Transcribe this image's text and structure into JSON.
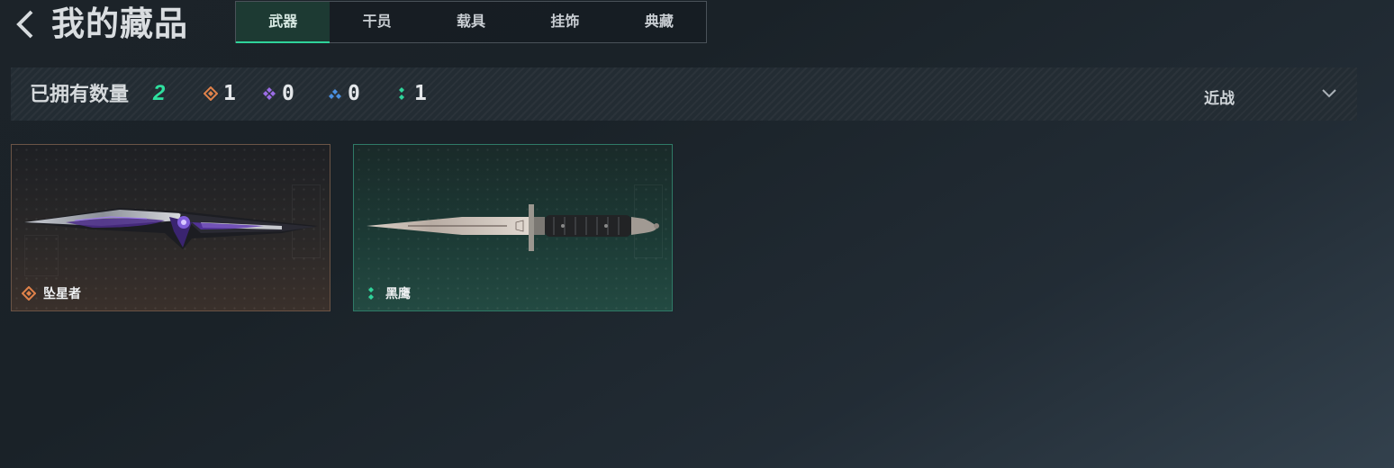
{
  "header": {
    "title": "我的藏品",
    "tabs": [
      {
        "label": "武器",
        "active": true
      },
      {
        "label": "干员",
        "active": false
      },
      {
        "label": "载具",
        "active": false
      },
      {
        "label": "挂饰",
        "active": false
      },
      {
        "label": "典藏",
        "active": false
      }
    ]
  },
  "stats": {
    "owned_label": "已拥有数量",
    "owned_count": "2",
    "rarity_counts": [
      {
        "icon": "orange-diamond-icon",
        "color": "#e0824a",
        "value": "1"
      },
      {
        "icon": "purple-diamond-icon",
        "color": "#9b6ce6",
        "value": "0"
      },
      {
        "icon": "blue-diamond-icon",
        "color": "#4a90e2",
        "value": "0"
      },
      {
        "icon": "green-diamond-icon",
        "color": "#2fd39a",
        "value": "1"
      }
    ]
  },
  "filter": {
    "selected": "近战"
  },
  "cards": [
    {
      "name": "坠星者",
      "rarity_color": "#e0824a",
      "rarity_icon": "orange-diamond-icon"
    },
    {
      "name": "黑鹰",
      "rarity_color": "#2fd39a",
      "rarity_icon": "green-diamond-icon"
    }
  ],
  "colors": {
    "accent": "#2fd39a",
    "background": "#1c2329"
  }
}
